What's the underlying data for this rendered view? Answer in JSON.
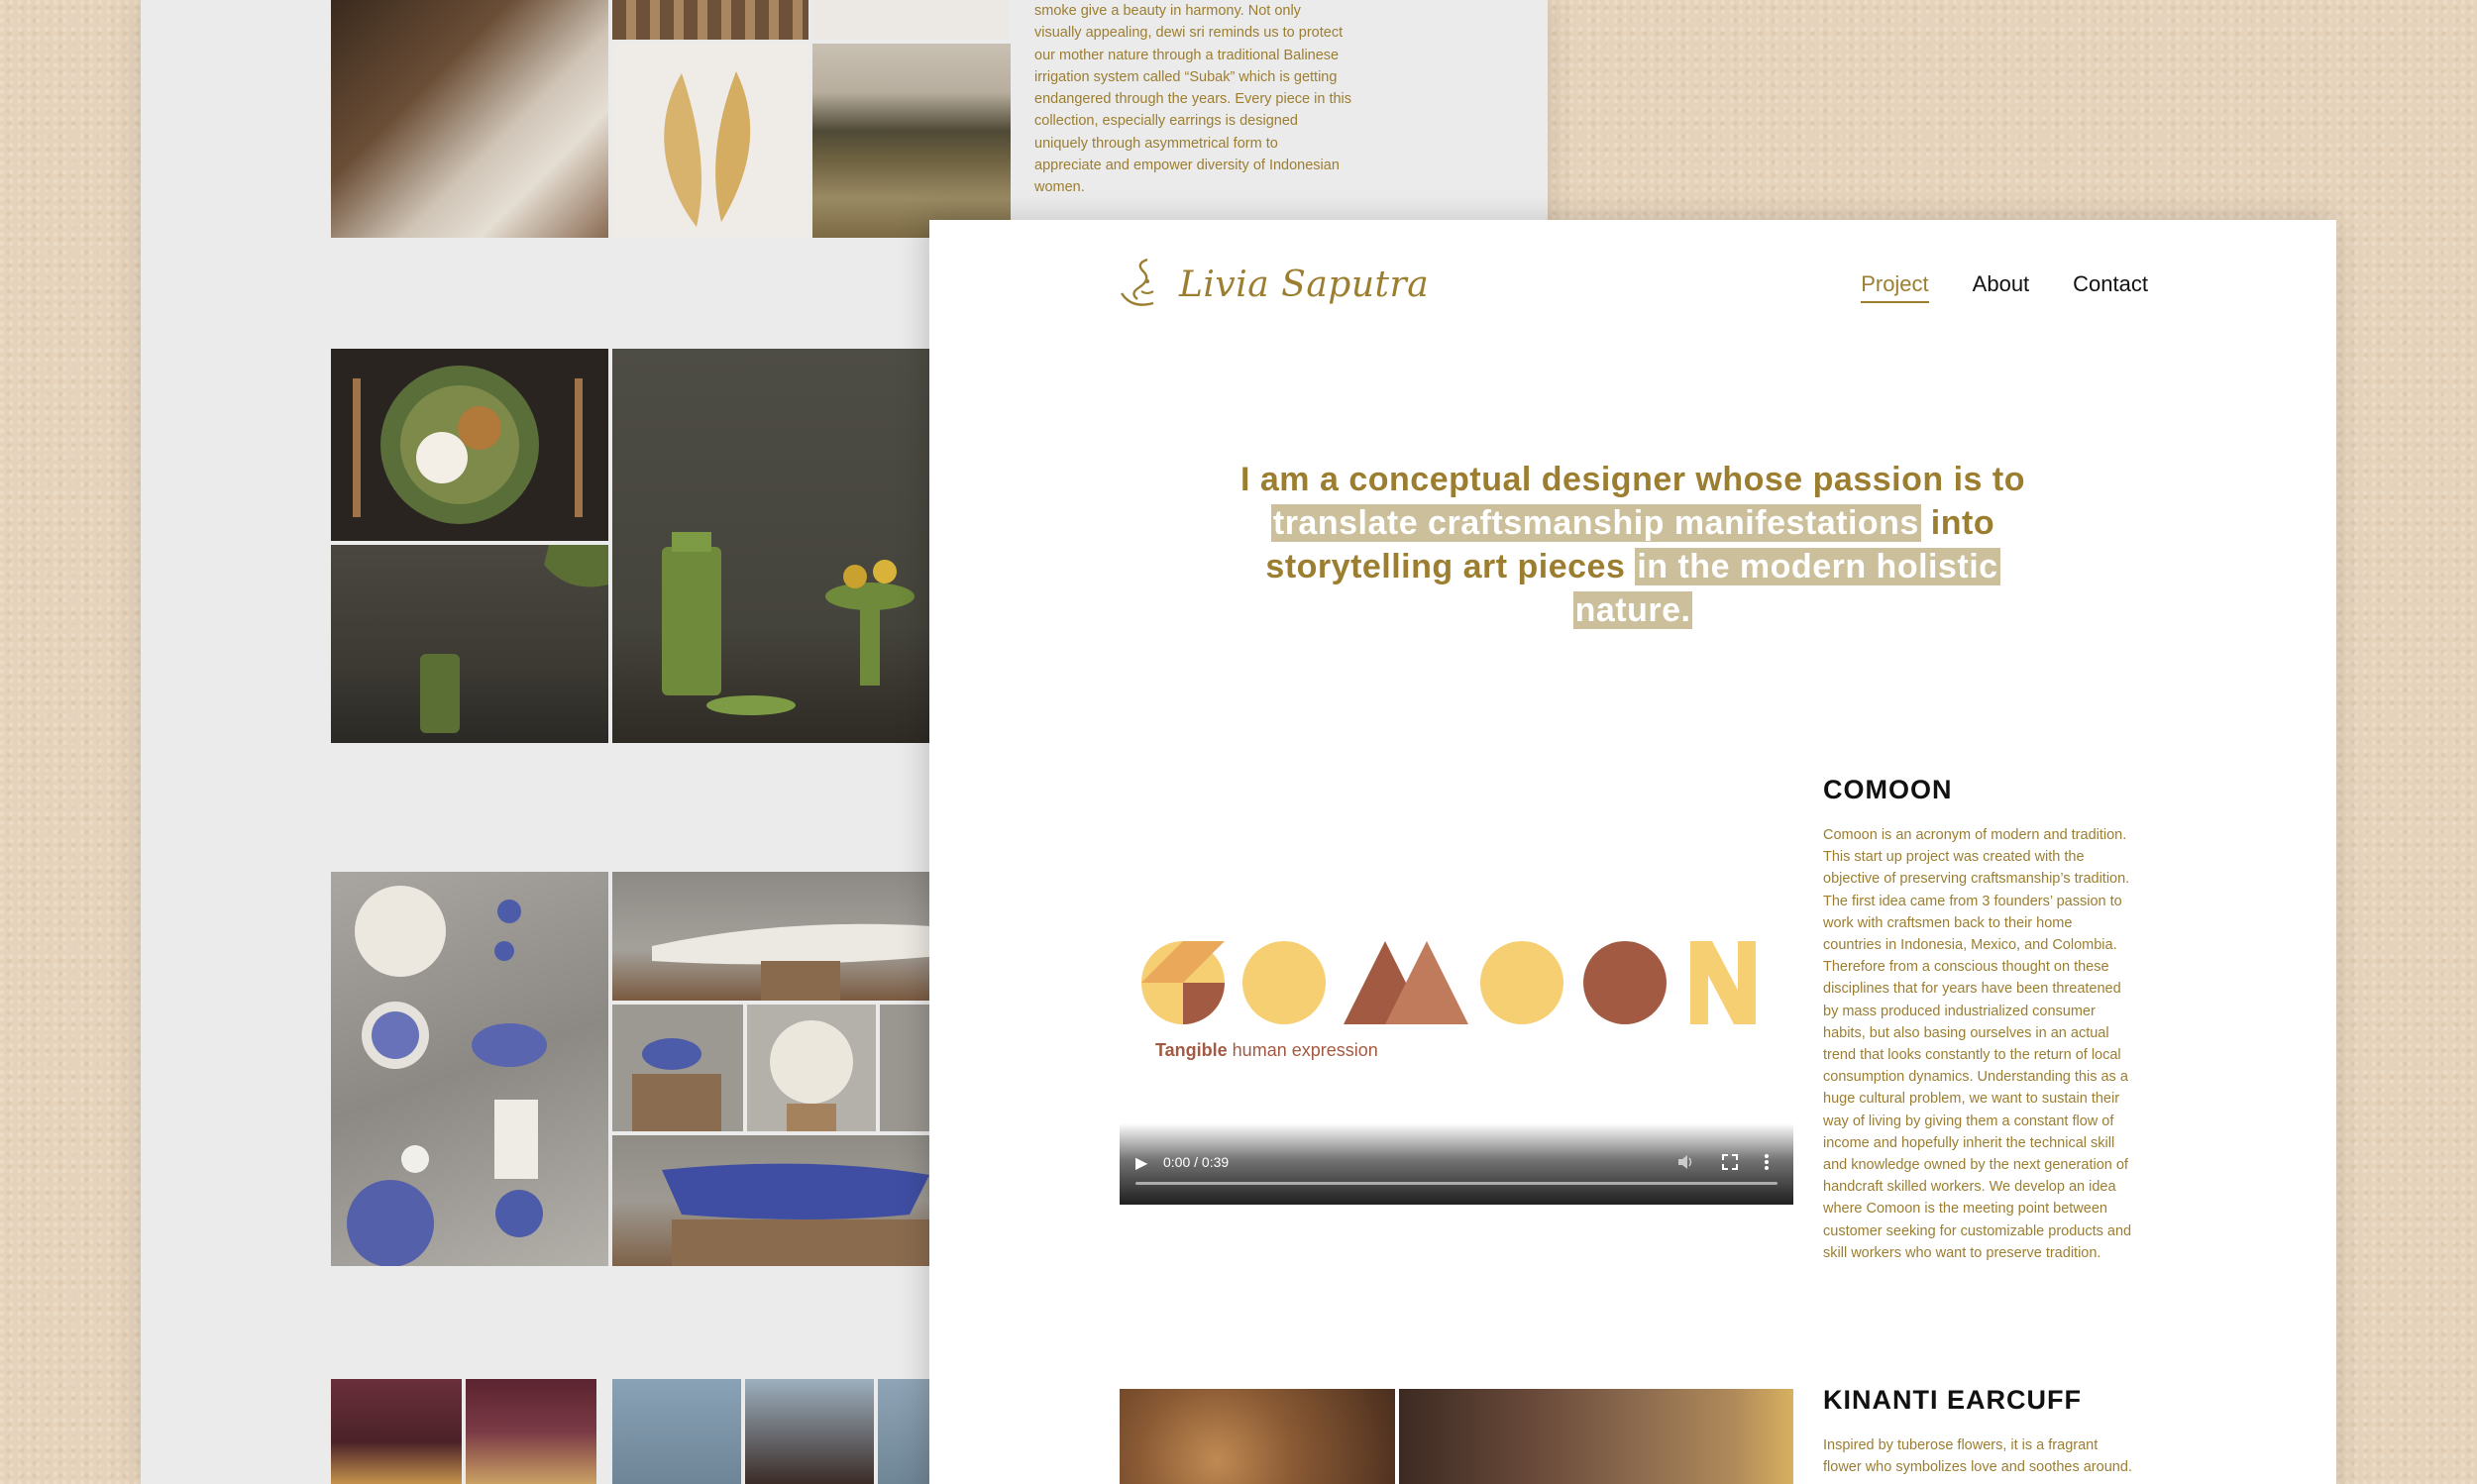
{
  "background_page": {
    "intro_lines": [
      "smoke give a beauty in harmony. Not only",
      "visually appealing, dewi sri reminds us to protect",
      "our mother nature through a traditional Balinese",
      "irrigation system called “Subak” which is getting",
      "endangered through the years. Every piece in this",
      "collection, especially earrings is designed",
      "uniquely through asymmetrical form to",
      "appreciate and empower diversity of Indonesian",
      "women."
    ]
  },
  "header": {
    "logo_text": "Livia Saputra",
    "nav": [
      {
        "label": "Project",
        "active": true
      },
      {
        "label": "About",
        "active": false
      },
      {
        "label": "Contact",
        "active": false
      }
    ]
  },
  "hero": {
    "line1": "I am a conceptual designer whose passion is to",
    "highlight1": "translate craftsmanship manifestations",
    "plain2": " into",
    "plain3": "storytelling art pieces ",
    "highlight2": "in the modern holistic",
    "highlight3": "nature."
  },
  "video": {
    "brand": "COMOON",
    "tagline_bold": "Tangible",
    "tagline_rest": " human expression",
    "time": "0:00 / 0:39",
    "icons": [
      "play-icon",
      "volume-icon",
      "fullscreen-icon",
      "more-icon"
    ]
  },
  "projects": [
    {
      "title": "COMOON",
      "lines": [
        "Comoon is an acronym of modern and tradition.",
        "This start up project was created with the",
        "objective of preserving craftsmanship’s tradition.",
        "The first idea came from 3 founders’ passion to",
        "work with craftsmen back to their home",
        "countries in Indonesia, Mexico, and Colombia.",
        "Therefore from a conscious thought on these",
        "disciplines that for years have been threatened",
        "by mass produced industrialized consumer",
        "habits, but also basing ourselves in an actual",
        "trend that looks constantly to the return of local",
        "consumption dynamics. Understanding this as a",
        "huge cultural problem, we want to sustain their",
        "way of living by giving them a constant flow of",
        "income and hopefully inherit the technical skill",
        "and knowledge owned by the next generation of",
        "handcraft skilled workers. We develop an idea",
        "where Comoon is the meeting point between",
        "customer seeking for customizable products and",
        "skill workers who want to preserve tradition."
      ]
    },
    {
      "title": "KINANTI EARCUFF",
      "lines": [
        "Inspired by tuberose flowers, it is a fragrant",
        "flower who symbolizes love and soothes around."
      ]
    }
  ],
  "colors": {
    "accent": "#9c7e31",
    "highlight": "#cbc09b",
    "comoon_gold": "#f6cf73",
    "comoon_brown": "#a35a43"
  }
}
